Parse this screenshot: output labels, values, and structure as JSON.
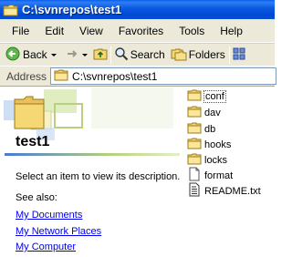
{
  "window": {
    "title": "C:\\svnrepos\\test1"
  },
  "menu": [
    "File",
    "Edit",
    "View",
    "Favorites",
    "Tools",
    "Help"
  ],
  "toolbar": {
    "back": "Back",
    "search": "Search",
    "folders": "Folders"
  },
  "address": {
    "label": "Address",
    "value": "C:\\svnrepos\\test1"
  },
  "webview": {
    "folder_name": "test1",
    "description": "Select an item to view its description.",
    "see_also": "See also:",
    "links": [
      "My Documents",
      "My Network Places",
      "My Computer"
    ]
  },
  "files": [
    {
      "name": "conf",
      "type": "folder",
      "selected": true
    },
    {
      "name": "dav",
      "type": "folder"
    },
    {
      "name": "db",
      "type": "folder"
    },
    {
      "name": "hooks",
      "type": "folder"
    },
    {
      "name": "locks",
      "type": "folder"
    },
    {
      "name": "format",
      "type": "file"
    },
    {
      "name": "README.txt",
      "type": "text-file"
    }
  ],
  "colors": {
    "titlebar": "#0054e3",
    "chrome": "#ece9d8",
    "folder": "#f5d773",
    "link": "#0000ee"
  }
}
